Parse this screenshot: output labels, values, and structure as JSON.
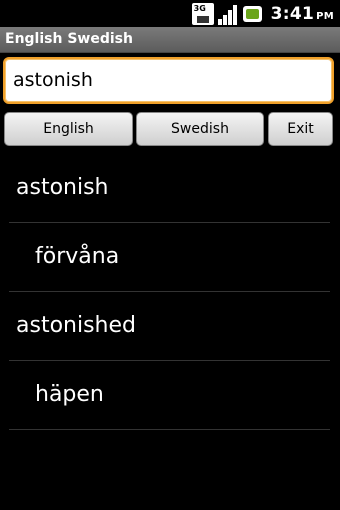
{
  "status_bar": {
    "network_label": "3G",
    "time": "3:41",
    "ampm": "PM",
    "icons": [
      "3g-data-icon",
      "signal-strength-icon",
      "battery-charging-icon"
    ]
  },
  "app": {
    "title": "English Swedish"
  },
  "search": {
    "value": "astonish",
    "placeholder": ""
  },
  "buttons": {
    "english": "English",
    "swedish": "Swedish",
    "exit": "Exit"
  },
  "results": [
    {
      "text": "astonish",
      "indent": false
    },
    {
      "text": "förvåna",
      "indent": true
    },
    {
      "text": "astonished",
      "indent": false
    },
    {
      "text": "häpen",
      "indent": true
    }
  ],
  "colors": {
    "focus_border": "#f0a02a",
    "battery_fill": "#6aa51a"
  }
}
